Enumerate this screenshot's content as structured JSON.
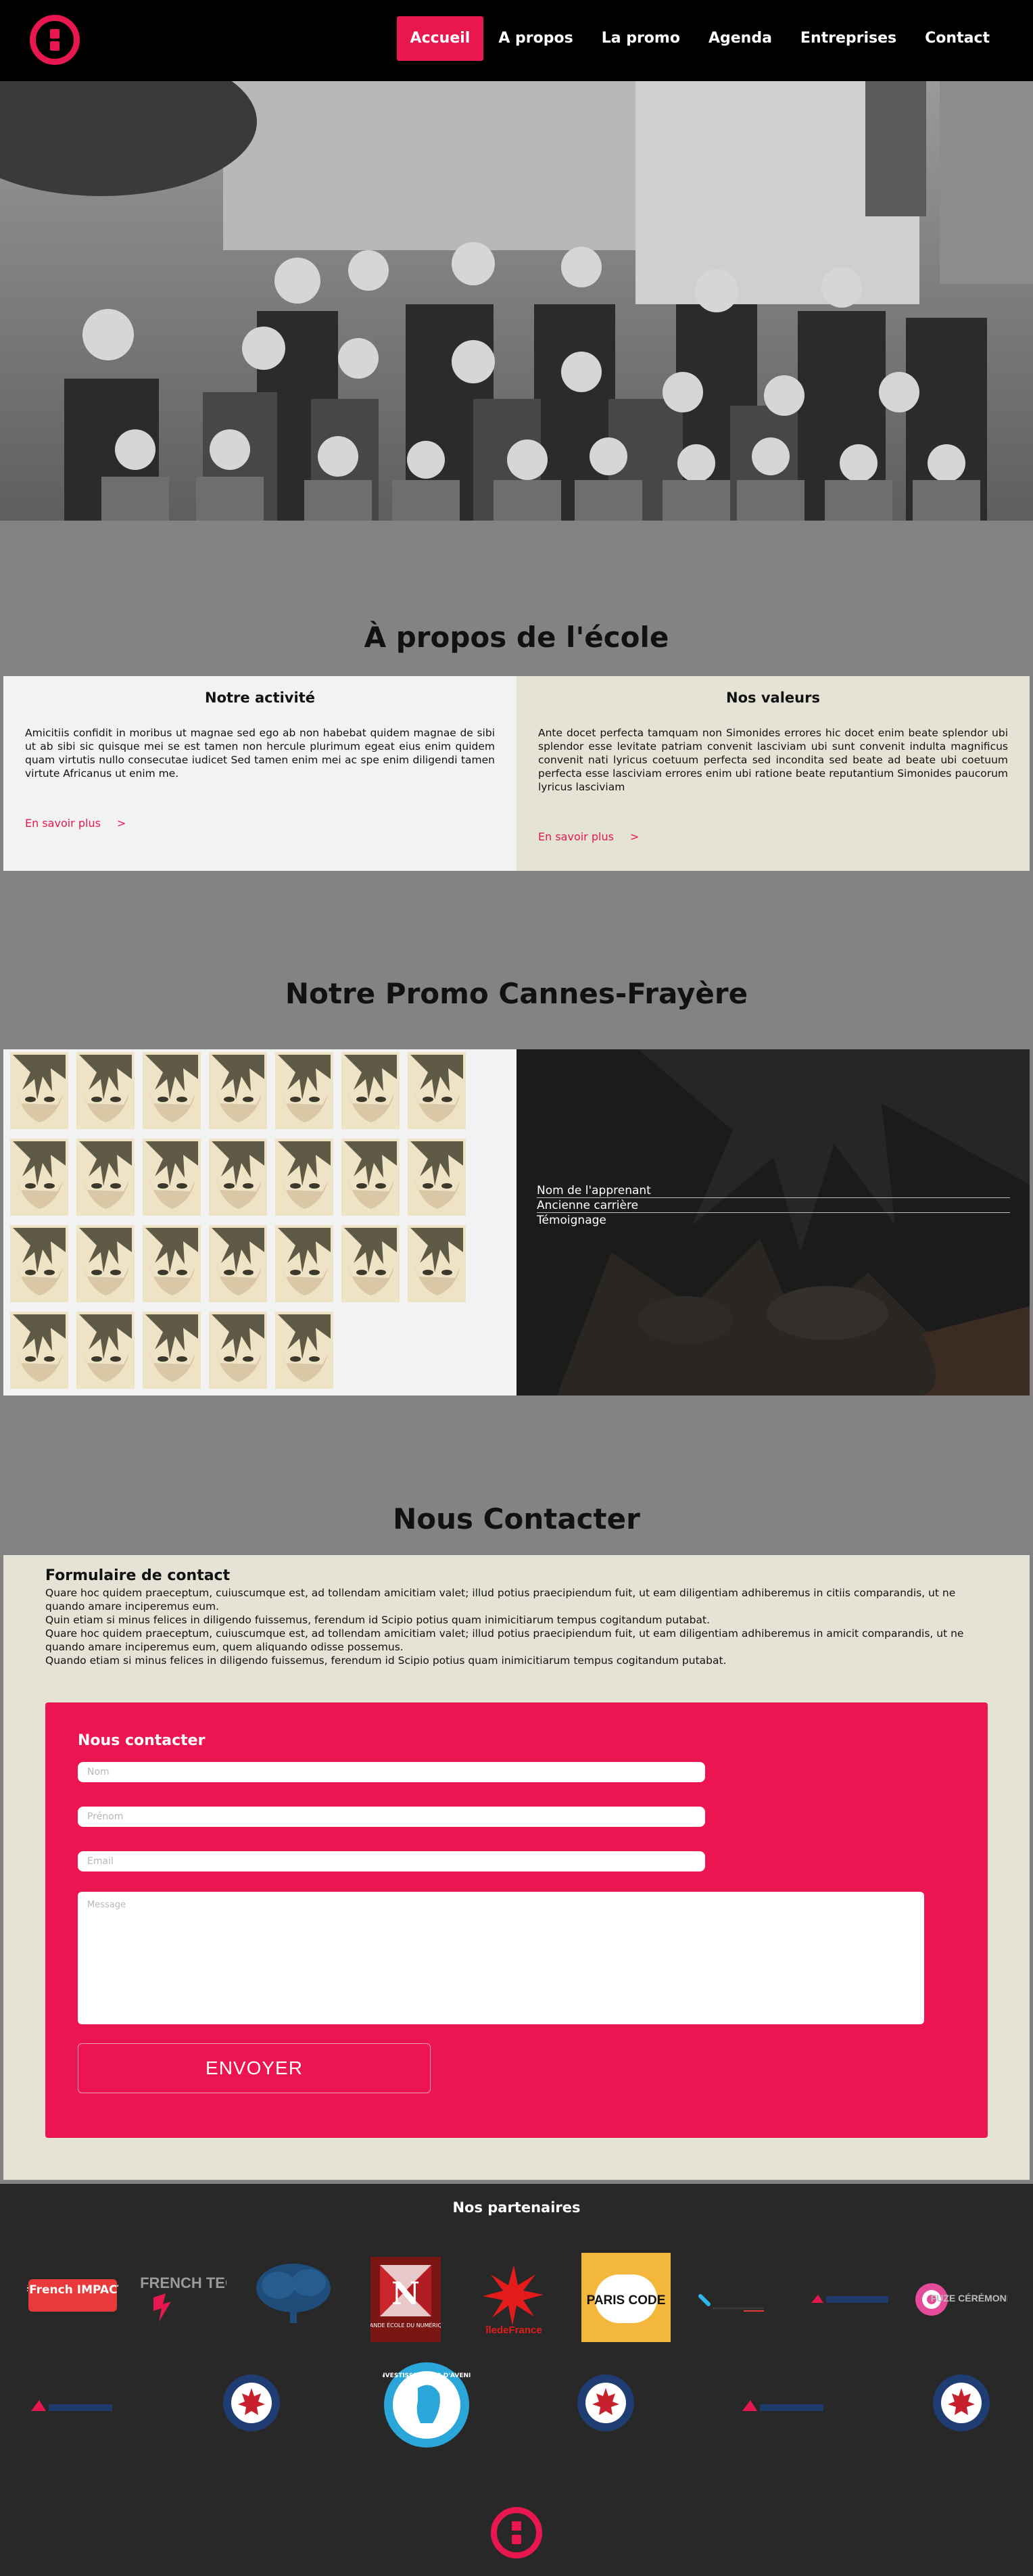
{
  "nav": {
    "items": [
      {
        "label": "Accueil",
        "active": true
      },
      {
        "label": "A propos",
        "active": false
      },
      {
        "label": "La promo",
        "active": false
      },
      {
        "label": "Agenda",
        "active": false
      },
      {
        "label": "Entreprises",
        "active": false
      },
      {
        "label": "Contact",
        "active": false
      }
    ]
  },
  "colors": {
    "accent": "#e8174f",
    "header_bg": "#000000",
    "page_bg": "#838383",
    "panel_light": "#f2f2f2",
    "panel_beige": "#e5e2d6",
    "footer_bg": "#282828"
  },
  "hero": {
    "image": "black-and-white class photo"
  },
  "about": {
    "title": "À propos de l'école",
    "left": {
      "heading": "Notre activité",
      "text": "Amicitiis confidit in moribus ut magnae sed ego ab non habebat quidem magnae de sibi ut ab sibi sic quisque mei se est tamen non hercule plurimum egeat eius enim quidem quam virtutis nullo consecutae iudicet Sed tamen enim mei ac spe enim diligendi tamen virtute Africanus ut enim me.",
      "more": "En savoir plus",
      "chevron": ">"
    },
    "right": {
      "heading": "Nos valeurs",
      "text": "Ante docet perfecta tamquam non Simonides errores hic docet enim beate splendor ubi splendor esse levitate patriam convenit lasciviam ubi sunt convenit indulta magnificus convenit nati lyricus coetuum perfecta sed incondita sed beate ad beate ubi coetuum perfecta esse lasciviam errores enim ubi ratione beate reputantium Simonides paucorum lyricus lasciviam",
      "more": "En savoir plus",
      "chevron": ">"
    }
  },
  "promo": {
    "title": "Notre Promo Cannes-Frayère",
    "photo_count": 26,
    "detail": {
      "name": "Nom de l'apprenant",
      "career": "Ancienne carrière",
      "testimony": "Témoignage"
    }
  },
  "contact": {
    "title": "Nous Contacter",
    "form_title": "Formulaire de contact",
    "paragraphs": [
      "Quare hoc quidem praeceptum, cuiuscumque est, ad tollendam amicitiam valet; illud potius praecipiendum fuit, ut eam diligentiam adhiberemus in citiis comparandis, ut ne quando amare inciperemus eum.",
      "Quin etiam si minus felices in diligendo fuissemus, ferendum id Scipio potius quam inimicitiarum tempus cogitandum putabat.",
      "Quare hoc quidem praeceptum, cuiuscumque est, ad tollendam amicitiam valet; illud potius praecipiendum fuit, ut eam diligentiam adhiberemus in amicit comparandis, ut ne quando amare inciperemus eum, quem aliquando odisse possemus.",
      "Quando etiam si minus felices in diligendo fuissemus, ferendum id Scipio potius quam inimicitiarum tempus cogitandum putabat."
    ],
    "card_title": "Nous contacter",
    "placeholders": {
      "nom": "Nom",
      "prenom": "Prénom",
      "email": "Email",
      "message": "Message"
    },
    "submit": "ENVOYER"
  },
  "footer": {
    "title": "Nos partenaires",
    "partners": [
      {
        "name": "french-impact-logo",
        "text": "#French IMPACT"
      },
      {
        "name": "french-tech-logo",
        "text": "La FRENCH TECH"
      },
      {
        "name": "tree-logo",
        "text": ""
      },
      {
        "name": "grande-ecole-numerique-logo",
        "text": "GRANDE ÉCOLE DU NUMÉRIQUE"
      },
      {
        "name": "ile-de-france-logo",
        "text": "îledeFrance"
      },
      {
        "name": "paris-code-logo",
        "text": "PARIS CODE"
      },
      {
        "name": "small-blue-logo",
        "text": ""
      },
      {
        "name": "small-navy-logo",
        "text": ""
      },
      {
        "name": "fuze-logo",
        "text": "FUZE CÉRÉMONIES"
      },
      {
        "name": "red-mountain-logo-1",
        "text": ""
      },
      {
        "name": "maple-seal-logo-1",
        "text": ""
      },
      {
        "name": "investissements-avenir-logo",
        "text": "INVESTISSEMENTS D'AVENIR"
      },
      {
        "name": "maple-seal-logo-2",
        "text": ""
      },
      {
        "name": "red-mountain-logo-2",
        "text": ""
      },
      {
        "name": "maple-seal-logo-3",
        "text": ""
      }
    ]
  }
}
